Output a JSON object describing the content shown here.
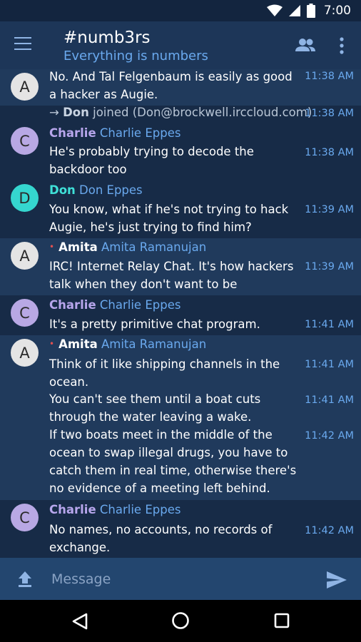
{
  "status": {
    "time": "7:00"
  },
  "toolbar": {
    "title": "#numb3rs",
    "subtitle": "Everything is numbers"
  },
  "icons": {
    "menu": "hamburger-menu-icon",
    "members": "people-icon",
    "overflow": "more-vert-icon",
    "upload": "upload-icon",
    "send": "send-icon",
    "wifi": "wifi-icon",
    "signal": "cellular-signal-icon",
    "battery": "battery-icon",
    "back": "back-triangle-icon",
    "home": "home-circle-icon",
    "recents": "recents-square-icon"
  },
  "colors": {
    "background": "#1a2d4a",
    "toolbar": "#1d3658",
    "accent": "#6aa9ee",
    "nick_purple": "#b7a6ec",
    "nick_teal": "#3fe0d8",
    "op_dot": "#e05050"
  },
  "messages": {
    "m1": {
      "avatar": "A",
      "lines": "No. And Tal Felgenbaum is easily as good a hacker as Augie.",
      "time": "11:38 AM"
    },
    "join": {
      "arrow": "→",
      "nick": "Don",
      "text": "joined (Don@brockwell.irccloud.com)",
      "time": "11:38 AM"
    },
    "m2": {
      "avatar": "C",
      "nick": "Charlie",
      "realname": "Charlie Eppes",
      "text": "He's probably trying to decode the backdoor too",
      "time": "11:38 AM"
    },
    "m3": {
      "avatar": "D",
      "nick": "Don",
      "realname": "Don Eppes",
      "text": "You know, what if he's not trying to hack Augie, he's just trying to find him?",
      "time": "11:39 AM"
    },
    "m4": {
      "avatar": "A",
      "nick": "Amita",
      "realname": "Amita Ramanujan",
      "dot": "•",
      "text": "IRC! Internet Relay Chat. It's how hackers talk when they don't want to be overheard.",
      "time": "11:39 AM"
    },
    "m5": {
      "avatar": "C",
      "nick": "Charlie",
      "realname": "Charlie Eppes",
      "text": "It's a pretty primitive chat program.",
      "time": "11:41 AM"
    },
    "m6": {
      "avatar": "A",
      "nick": "Amita",
      "realname": "Amita Ramanujan",
      "dot": "•",
      "text1": "Think of it like shipping channels in the ocean.",
      "time1": "11:41 AM",
      "text2": "You can't see them until a boat cuts through the water leaving a wake.",
      "time2": "11:41 AM",
      "text3": "If two boats meet in the middle of the ocean to swap illegal drugs, you have to catch them in real time, otherwise there's no evidence of a meeting left behind.",
      "time3": "11:42 AM"
    },
    "m7": {
      "avatar": "C",
      "nick": "Charlie",
      "realname": "Charlie Eppes",
      "text": "No names, no accounts, no records of exchange.",
      "time": "11:42 AM"
    }
  },
  "composer": {
    "placeholder": "Message"
  }
}
